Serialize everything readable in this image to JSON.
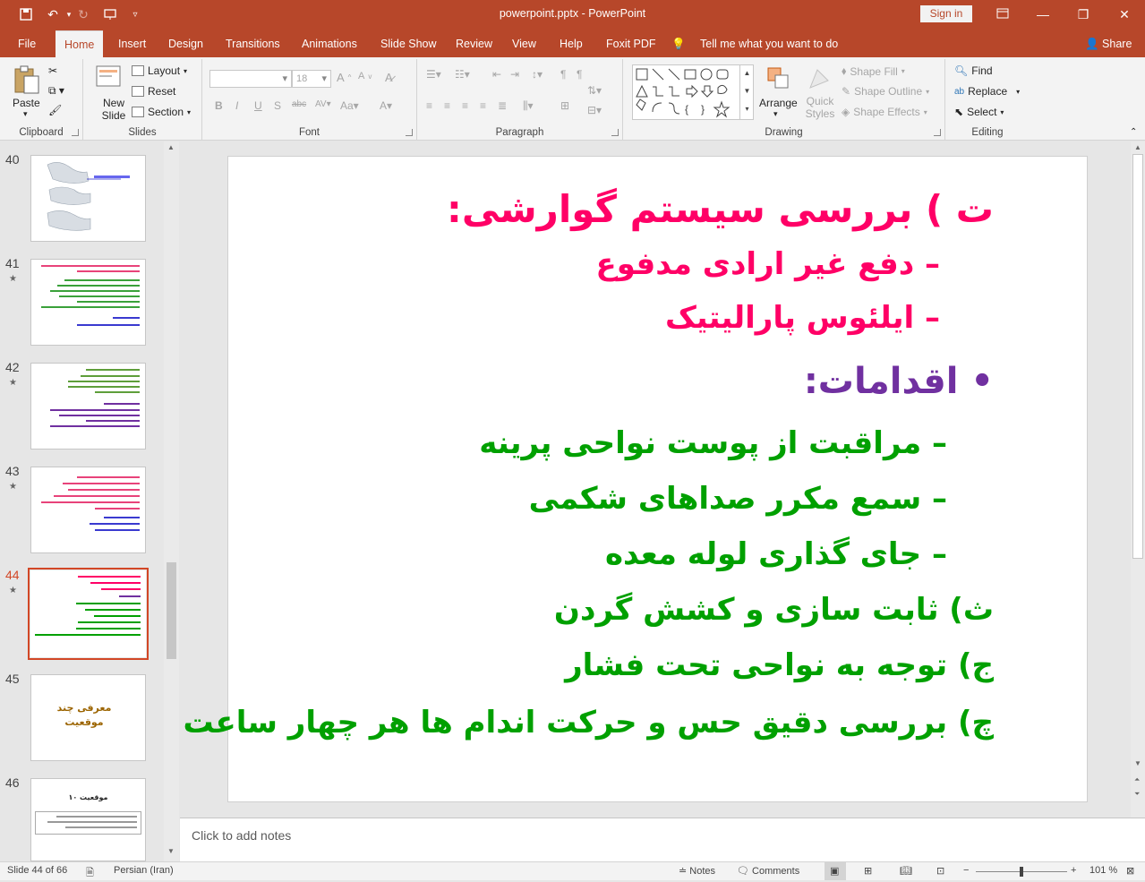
{
  "window": {
    "title": "powerpoint.pptx  -  PowerPoint",
    "sign_in": "Sign in"
  },
  "tabs": [
    "File",
    "Home",
    "Insert",
    "Design",
    "Transitions",
    "Animations",
    "Slide Show",
    "Review",
    "View",
    "Help",
    "Foxit PDF",
    "Tell me what you want to do",
    "Share"
  ],
  "ribbon": {
    "clipboard": {
      "paste": "Paste",
      "label": "Clipboard"
    },
    "slides": {
      "new_slide": "New Slide",
      "layout": "Layout",
      "reset": "Reset",
      "section": "Section",
      "label": "Slides"
    },
    "font": {
      "size": "18",
      "label": "Font"
    },
    "paragraph": {
      "label": "Paragraph"
    },
    "drawing": {
      "arrange": "Arrange",
      "quick_styles": "Quick Styles",
      "shape_fill": "Shape Fill",
      "shape_outline": "Shape Outline",
      "shape_effects": "Shape Effects",
      "label": "Drawing"
    },
    "editing": {
      "find": "Find",
      "replace": "Replace",
      "select": "Select",
      "label": "Editing"
    }
  },
  "thumbnails": [
    {
      "num": "40",
      "star": ""
    },
    {
      "num": "41",
      "star": "★"
    },
    {
      "num": "42",
      "star": "★"
    },
    {
      "num": "43",
      "star": "★"
    },
    {
      "num": "44",
      "star": "★"
    },
    {
      "num": "45",
      "star": ""
    },
    {
      "num": "46",
      "star": "★"
    }
  ],
  "thumb_text": {
    "slide45_line1": "معرفی چند",
    "slide45_line2": "موقعیت",
    "slide46_title": "موقعیت ۱۰"
  },
  "slide": {
    "lines": [
      {
        "text": "ت ) بررسی سیستم گوارشی:",
        "color": "#ff0066"
      },
      {
        "text": "–  دفع غیر ارادی مدفوع",
        "color": "#ff0066"
      },
      {
        "text": "–  ایلئوس پارالیتیک",
        "color": "#ff0066"
      },
      {
        "text": "•  اقدامات:",
        "color": "#7030a0"
      },
      {
        "text": "– مراقبت از پوست نواحی پرینه",
        "color": "#00a000"
      },
      {
        "text": "– سمع مکرر صداهای شکمی",
        "color": "#00a000"
      },
      {
        "text": "– جای گذاری لوله معده",
        "color": "#00a000"
      },
      {
        "text": "ث) ثابت سازی و کشش گردن",
        "color": "#00a000"
      },
      {
        "text": "ج) توجه به نواحی تحت فشار",
        "color": "#00a000"
      },
      {
        "text": "چ) بررسی دقیق حس و حرکت اندام ها هر چهار ساعت",
        "color": "#00a000"
      }
    ]
  },
  "notes": {
    "placeholder": "Click to add notes"
  },
  "status": {
    "slide_info": "Slide 44 of 66",
    "language": "Persian (Iran)",
    "notes": "Notes",
    "comments": "Comments",
    "zoom": "101 %"
  }
}
